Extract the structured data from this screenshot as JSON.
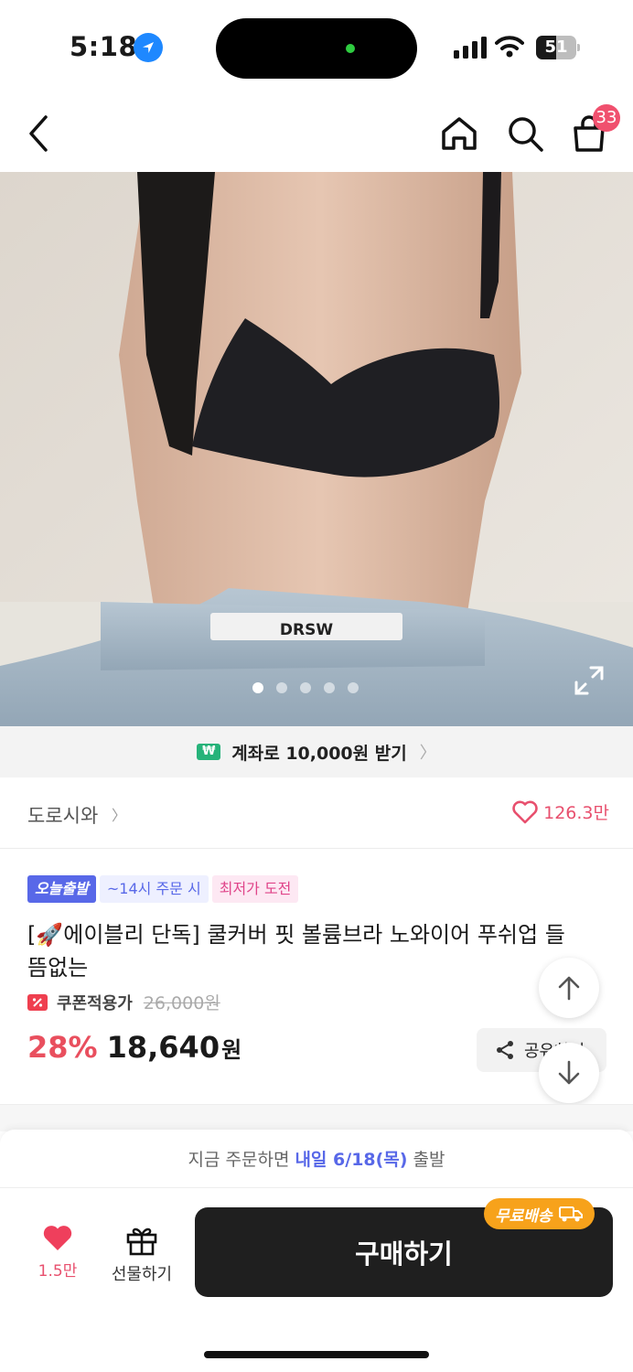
{
  "status_bar": {
    "time": "5:18",
    "battery": "51",
    "battery_level": 0.51
  },
  "nav": {
    "cart_count": "33"
  },
  "gallery": {
    "total_images": 5,
    "active_index": 0,
    "waistband_text": "DRSW"
  },
  "promo": {
    "text": "계좌로 10,000원 받기",
    "icon_text": "₩"
  },
  "seller": {
    "name": "도로시와",
    "likes": "126.3만"
  },
  "tags": {
    "today": "오늘출발",
    "deadline": "~14시 주문 시",
    "lowest": "최저가 도전"
  },
  "product": {
    "title": "[🚀에이블리 단독] 쿨커버 핏 볼륨브라 노와이어 푸쉬업 들뜸없는",
    "coupon_label": "쿠폰적용가",
    "original_price": "26,000원",
    "discount": "28%",
    "price": "18,640",
    "price_unit": "원"
  },
  "share": {
    "label": "공유하기"
  },
  "shipping": {
    "prefix": "지금 주문하면",
    "highlight": "내일 6/18(목)",
    "suffix": "출발"
  },
  "actions": {
    "like_count": "1.5만",
    "gift_label": "선물하기",
    "buy_label": "구매하기",
    "free_ship": "무료배송"
  },
  "colors": {
    "accent_pink": "#e8506e",
    "discount_red": "#e94f5e",
    "accent_blue": "#5868e8",
    "free_ship_orange": "#f7a21b"
  },
  "icons": [
    "back-icon",
    "home-icon",
    "search-icon",
    "cart-icon",
    "expand-icon",
    "won-icon",
    "heart-icon",
    "coupon-icon",
    "share-icon",
    "arrow-up-icon",
    "arrow-down-icon",
    "gift-icon",
    "truck-icon"
  ]
}
